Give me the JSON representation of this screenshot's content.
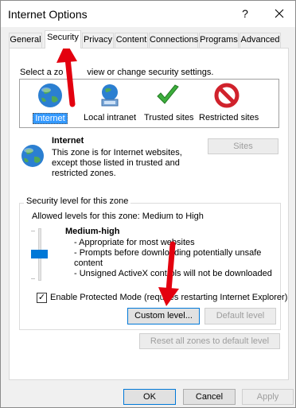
{
  "window": {
    "title": "Internet Options",
    "help": "?",
    "close": "✕"
  },
  "tabs": [
    {
      "label": "General",
      "active": false
    },
    {
      "label": "Security",
      "active": true
    },
    {
      "label": "Privacy",
      "active": false
    },
    {
      "label": "Content",
      "active": false
    },
    {
      "label": "Connections",
      "active": false
    },
    {
      "label": "Programs",
      "active": false
    },
    {
      "label": "Advanced",
      "active": false
    }
  ],
  "security": {
    "zone_hint": "Select a zo",
    "zone_hint_rest": "view or change security settings.",
    "zones": [
      {
        "label": "Internet",
        "icon": "globe-icon",
        "selected": true
      },
      {
        "label": "Local intranet",
        "icon": "intranet-icon",
        "selected": false
      },
      {
        "label": "Trusted sites",
        "icon": "checkmark-icon",
        "selected": false
      },
      {
        "label": "Restricted sites",
        "icon": "restricted-icon",
        "selected": false
      }
    ],
    "selected_zone": {
      "title": "Internet",
      "description": "This zone is for Internet websites, except those listed in trusted and restricted zones.",
      "sites_button": "Sites"
    },
    "level_group": {
      "legend": "Security level for this zone",
      "allowed": "Allowed levels for this zone: Medium to High",
      "level_name": "Medium-high",
      "bullets": [
        "- Appropriate for most websites",
        "- Prompts before downloading potentially unsafe",
        "content",
        "- Unsigned ActiveX controls will not be downloaded"
      ],
      "protected_mode_label": "Enable Protected Mode (requires restarting Internet Explorer)",
      "protected_mode_checked": true,
      "custom_level_button": "Custom level...",
      "default_level_button": "Default level"
    },
    "reset_button": "Reset all zones to default level"
  },
  "footer": {
    "ok": "OK",
    "cancel": "Cancel",
    "apply": "Apply"
  },
  "colors": {
    "accent": "#0078d7",
    "arrow": "#e3000f",
    "selected_zone_bg": "#3399ff"
  }
}
